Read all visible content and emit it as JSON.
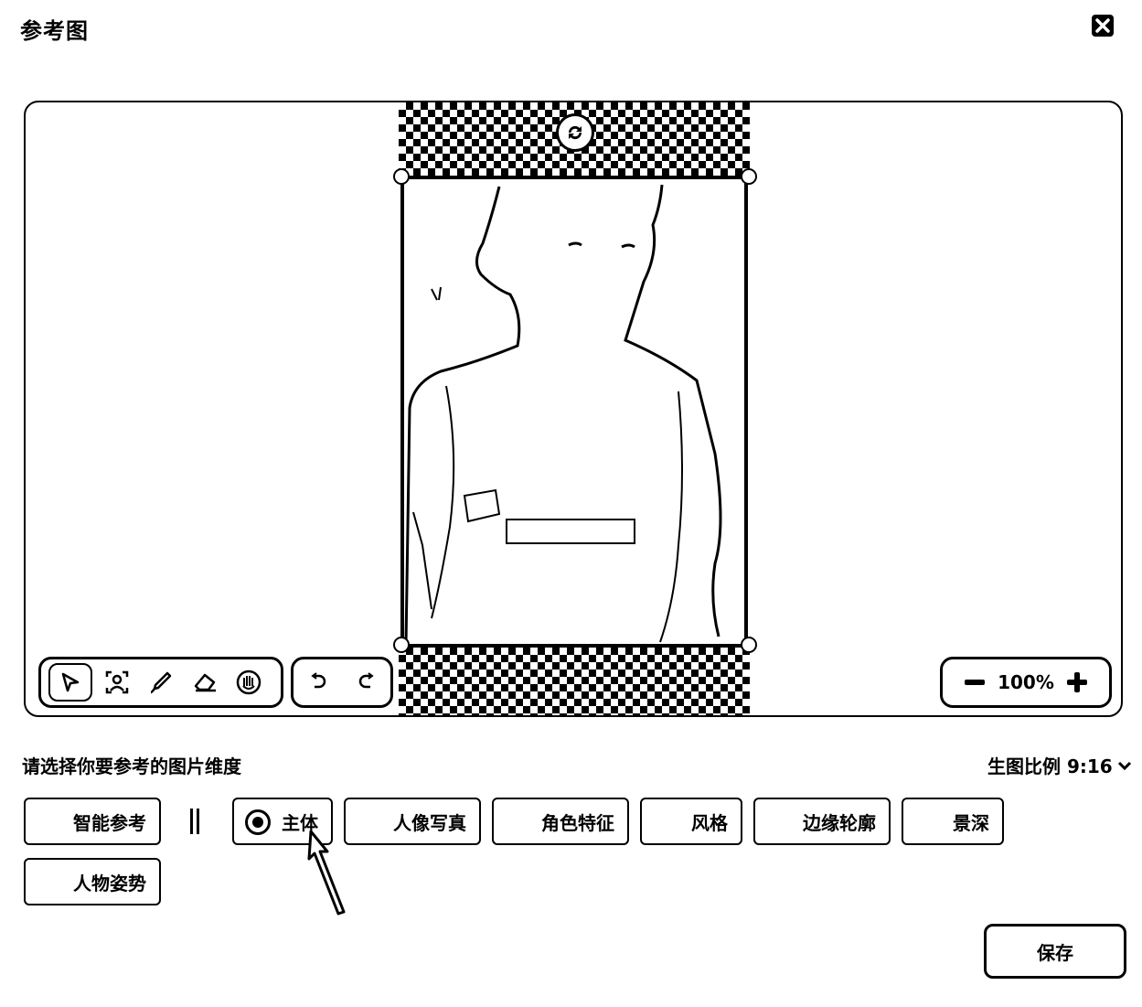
{
  "dialog": {
    "title": "参考图",
    "close_icon": "close-icon"
  },
  "canvas": {
    "tools": [
      "pointer-icon",
      "subject-select-icon",
      "brush-icon",
      "eraser-icon",
      "hand-icon"
    ],
    "history": [
      "undo-icon",
      "redo-icon"
    ],
    "zoom": {
      "value": "100%"
    }
  },
  "options": {
    "prompt": "请选择你要参考的图片维度",
    "ratio_label": "生图比例 9:16",
    "chips": [
      {
        "label": "智能参考"
      },
      {
        "label": "主体",
        "selected": true
      },
      {
        "label": "人像写真"
      },
      {
        "label": "角色特征"
      },
      {
        "label": "风格"
      },
      {
        "label": "边缘轮廓"
      },
      {
        "label": "景深"
      },
      {
        "label": "人物姿势"
      }
    ]
  },
  "footer": {
    "save_label": "保存"
  }
}
